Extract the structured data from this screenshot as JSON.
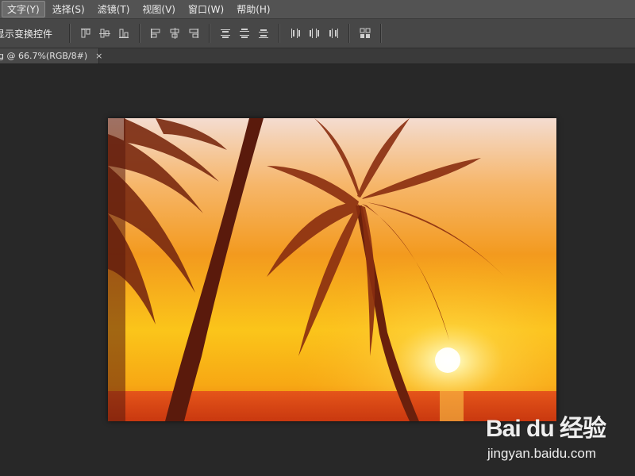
{
  "menubar": {
    "items": [
      {
        "label": "文字(Y)",
        "active": true
      },
      {
        "label": "选择(S)"
      },
      {
        "label": "滤镜(T)"
      },
      {
        "label": "视图(V)"
      },
      {
        "label": "窗口(W)"
      },
      {
        "label": "帮助(H)"
      }
    ]
  },
  "options": {
    "transform_controls_label": "显示变换控件"
  },
  "tab": {
    "title": "g @ 66.7%(RGB/8#)",
    "close": "×"
  },
  "watermark": {
    "logo_text": "Bai du 经验",
    "url": "jingyan.baidu.com"
  },
  "colors": {
    "menubar": "#535353",
    "optionsbar": "#474747",
    "workspace": "#282828"
  }
}
